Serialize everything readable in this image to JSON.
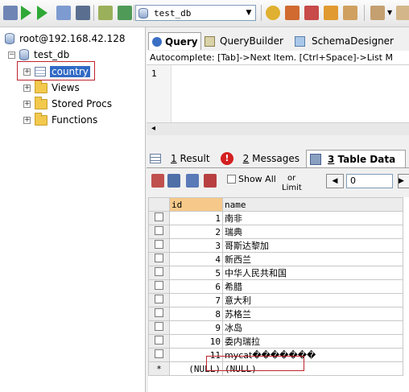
{
  "toolbar": {
    "db_select_value": "test_db"
  },
  "tree": {
    "root": "root@192.168.42.128",
    "database": "test_db",
    "items": [
      {
        "label": "country"
      },
      {
        "label": "Views"
      },
      {
        "label": "Stored Procs"
      },
      {
        "label": "Functions"
      }
    ]
  },
  "query_tabs": [
    {
      "label": "Query"
    },
    {
      "label": "QueryBuilder"
    },
    {
      "label": "SchemaDesigner"
    }
  ],
  "editor": {
    "autocomplete_hint": "Autocomplete: [Tab]->Next Item. [Ctrl+Space]->List M",
    "line_number": "1"
  },
  "result_tabs": [
    {
      "num": "1",
      "label": "Result"
    },
    {
      "num": "2",
      "label": "Messages"
    },
    {
      "num": "3",
      "label": "Table Data"
    }
  ],
  "result_toolbar": {
    "show_all_label": "Show All",
    "or_label": "or",
    "limit_label": "Limit",
    "offset_value": "0"
  },
  "grid": {
    "columns": [
      "id",
      "name"
    ],
    "rows": [
      {
        "id": "1",
        "name": "南非"
      },
      {
        "id": "2",
        "name": "瑞典"
      },
      {
        "id": "3",
        "name": "哥斯达黎加"
      },
      {
        "id": "4",
        "name": "新西兰"
      },
      {
        "id": "5",
        "name": "中华人民共和国"
      },
      {
        "id": "6",
        "name": "希腊"
      },
      {
        "id": "7",
        "name": "意大利"
      },
      {
        "id": "8",
        "name": "苏格兰"
      },
      {
        "id": "9",
        "name": "冰岛"
      },
      {
        "id": "10",
        "name": "委内瑞拉"
      },
      {
        "id": "11",
        "name": "mycat�������"
      }
    ],
    "new_row": {
      "marker": "*",
      "id": "(NULL)",
      "name": "(NULL)"
    }
  }
}
